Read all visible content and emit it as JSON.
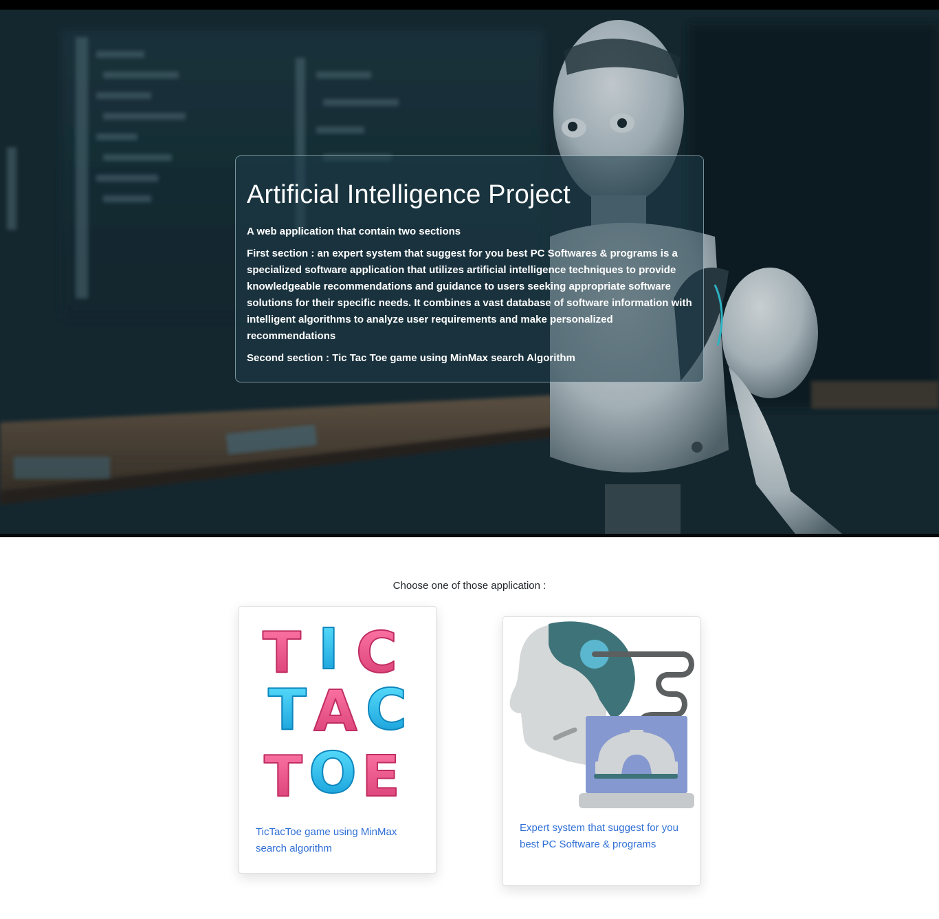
{
  "hero": {
    "title": "Artificial Intelligence Project",
    "intro": "A web application that contain two sections",
    "first_section": "First section : an expert system that suggest for you best PC Softwares & programs is a specialized software application that utilizes artificial intelligence techniques to provide knowledgeable recommendations and guidance to users seeking appropriate software solutions for their specific needs. It combines a vast database of software information with intelligent algorithms to analyze user requirements and make personalized recommendations",
    "second_section": "Second section : Tic Tac Toe game using MinMax search Algorithm"
  },
  "apps": {
    "prompt": "Choose one of those application :",
    "cards": [
      {
        "image_art": [
          "TIC",
          "TAC",
          "TOE"
        ],
        "icon": "tictactoe-logo-icon",
        "link": "TicTacToe game using MinMax search algorithm"
      },
      {
        "icon": "ai-head-laptop-gear-icon",
        "link": "Expert system that suggest for you best PC Software & programs"
      }
    ]
  },
  "colors": {
    "link": "#2f6fd6",
    "pink": "#ee4d84",
    "cyan": "#19c0ea",
    "teal": "#3d7479"
  }
}
